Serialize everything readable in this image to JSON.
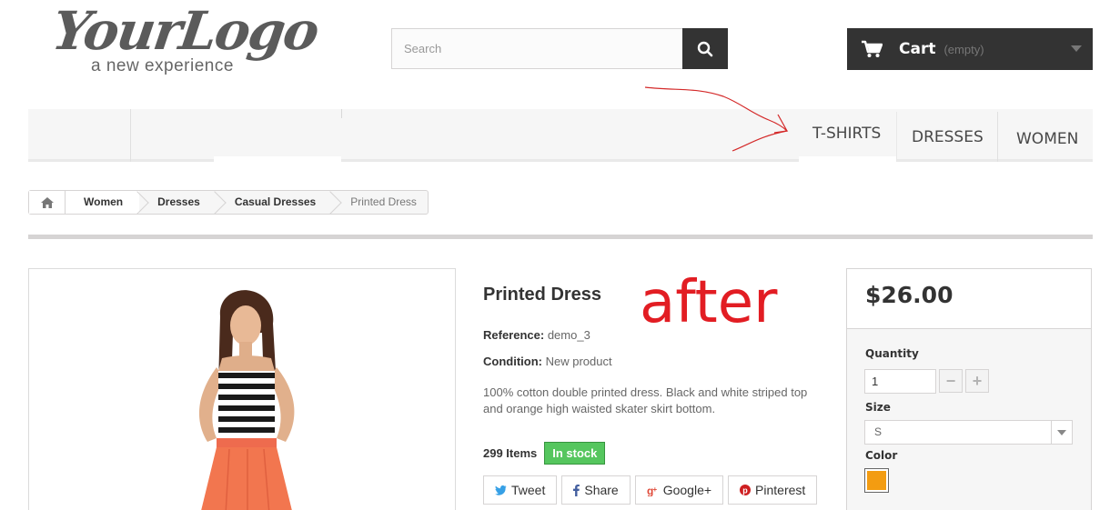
{
  "logo": {
    "script": "YourLogo",
    "tagline": "a new experience"
  },
  "search": {
    "placeholder": "Search",
    "icon": "search-icon"
  },
  "cart": {
    "label": "Cart",
    "status": "(empty)",
    "icon": "shopping-cart-icon"
  },
  "menu": {
    "items": [
      {
        "label": "T-SHIRTS"
      },
      {
        "label": "DRESSES"
      },
      {
        "label": "WOMEN"
      }
    ]
  },
  "annotation": {
    "text": "after",
    "color": "#e21d23"
  },
  "breadcrumb": {
    "home_icon": "home-icon",
    "items": [
      "Women",
      "Dresses",
      "Casual Dresses",
      "Printed Dress"
    ]
  },
  "product": {
    "name": "Printed Dress",
    "reference_label": "Reference:",
    "reference_value": "demo_3",
    "condition_label": "Condition:",
    "condition_value": "New product",
    "description": "100% cotton double printed dress. Black and white striped top and orange high waisted skater skirt bottom.",
    "items_count": "299 Items",
    "stock_status": "In stock",
    "stock_color": "#55c65e"
  },
  "social": [
    {
      "label": "Tweet",
      "icon": "twitter-icon"
    },
    {
      "label": "Share",
      "icon": "facebook-icon"
    },
    {
      "label": "Google+",
      "icon": "google-plus-icon"
    },
    {
      "label": "Pinterest",
      "icon": "pinterest-icon"
    }
  ],
  "buy_box": {
    "price": "$26.00",
    "quantity_label": "Quantity",
    "quantity_value": "1",
    "minus": "−",
    "plus": "+",
    "size_label": "Size",
    "size_value": "S",
    "color_label": "Color",
    "color_swatch": "#f39c11"
  }
}
